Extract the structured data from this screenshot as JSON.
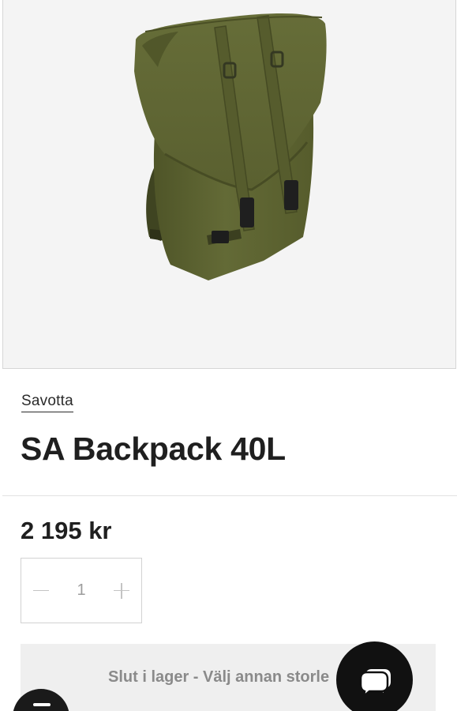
{
  "product": {
    "brand": "Savotta",
    "title": "SA Backpack 40L",
    "price": "2 195 kr",
    "image_icon": "backpack-image"
  },
  "quantity": {
    "value": "1",
    "decrement_icon": "minus-icon",
    "increment_icon": "plus-icon"
  },
  "actions": {
    "stock_label": "Slut i lager - Välj annan storle",
    "chat_icon": "chat-bubbles-icon"
  },
  "colors": {
    "backpack": "#5b6131",
    "chat_button": "#111111",
    "disabled_button": "#efefef"
  }
}
